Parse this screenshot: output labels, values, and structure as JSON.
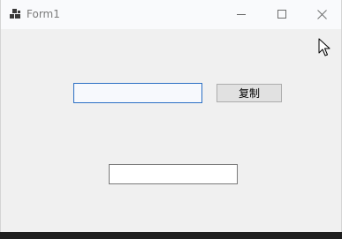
{
  "window": {
    "title": "Form1",
    "icons": {
      "app": "app-icon",
      "minimize": "minimize-icon",
      "maximize": "maximize-icon",
      "close": "close-icon"
    }
  },
  "form": {
    "input_top": {
      "value": "",
      "placeholder": ""
    },
    "copy_button": {
      "label": "复制"
    },
    "input_bottom": {
      "value": "",
      "placeholder": ""
    }
  },
  "colors": {
    "focus_border": "#2b6fc4",
    "client_bg": "#f0f0f0",
    "titlebar_bg": "#f9fafc"
  }
}
